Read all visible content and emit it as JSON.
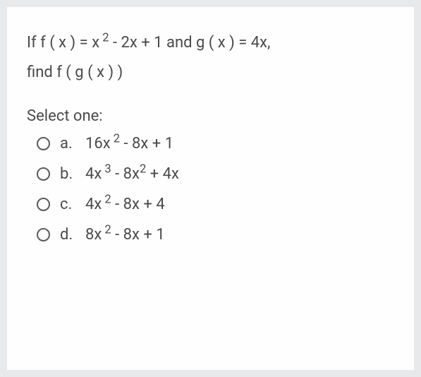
{
  "question": {
    "line1_pre": "If f ( x ) = x",
    "line1_exp1": " 2",
    "line1_mid": " - 2x + 1 and g ( x ) = 4x,",
    "line2": "find f ( g ( x ) )"
  },
  "select_prompt": "Select one:",
  "options": [
    {
      "letter": "a.",
      "parts": [
        {
          "t": "16x",
          "sup": false
        },
        {
          "t": " 2",
          "sup": true
        },
        {
          "t": " - 8x + 1",
          "sup": false
        }
      ]
    },
    {
      "letter": "b.",
      "parts": [
        {
          "t": "4x",
          "sup": false
        },
        {
          "t": " 3",
          "sup": true
        },
        {
          "t": " - 8x",
          "sup": false
        },
        {
          "t": "2",
          "sup": true
        },
        {
          "t": " + 4x",
          "sup": false
        }
      ]
    },
    {
      "letter": "c.",
      "parts": [
        {
          "t": "4x",
          "sup": false
        },
        {
          "t": " 2",
          "sup": true
        },
        {
          "t": " - 8x + 4",
          "sup": false
        }
      ]
    },
    {
      "letter": "d.",
      "parts": [
        {
          "t": "8x",
          "sup": false
        },
        {
          "t": " 2",
          "sup": true
        },
        {
          "t": " - 8x + 1",
          "sup": false
        }
      ]
    }
  ]
}
